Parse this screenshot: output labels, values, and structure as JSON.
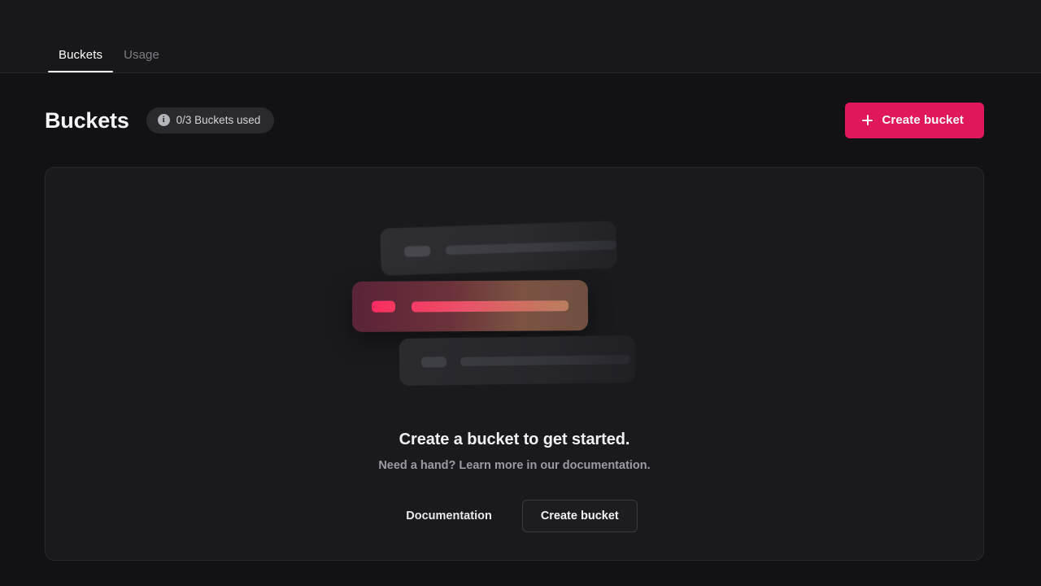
{
  "tabs": [
    {
      "label": "Buckets",
      "active": true
    },
    {
      "label": "Usage",
      "active": false
    }
  ],
  "header": {
    "title": "Buckets",
    "badge": {
      "icon": "info-icon",
      "text": "0/3 Buckets used"
    },
    "create_button": {
      "icon": "plus-icon",
      "label": "Create bucket"
    }
  },
  "empty_state": {
    "title": "Create a bucket to get started.",
    "subtitle": "Need a hand? Learn more in our documentation.",
    "documentation_button": "Documentation",
    "create_button": "Create bucket"
  },
  "colors": {
    "page_background": "#121214",
    "topbar_background": "#18181a",
    "card_background": "#1a1a1e",
    "card_border": "#29292d",
    "accent": "#e0175a",
    "accent_bright": "#fb2b63",
    "text_primary": "#ffffff",
    "text_muted": "#9b9ba3",
    "tab_inactive": "#7d7d85",
    "badge_background": "#2a2a2e"
  }
}
